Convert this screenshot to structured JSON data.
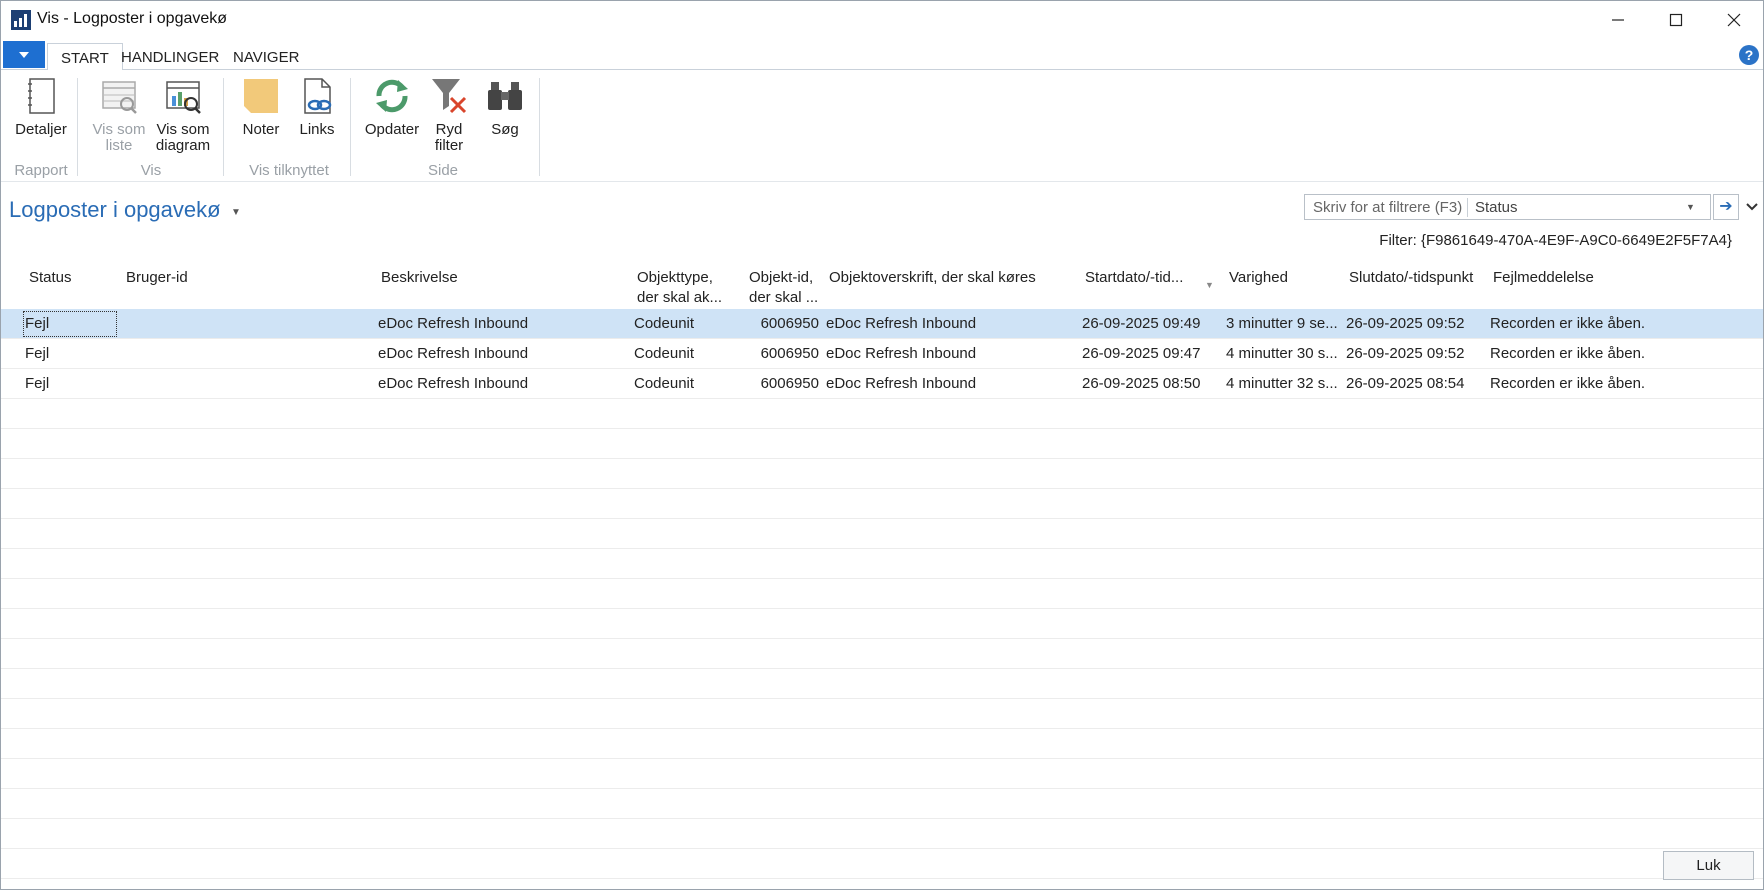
{
  "window": {
    "title": "Vis - Logposter i opgavekø"
  },
  "ribbon": {
    "tabs": [
      "START",
      "HANDLINGER",
      "NAVIGER"
    ],
    "buttons": {
      "details": "Detaljer",
      "list_line1": "Vis som",
      "list_line2": "liste",
      "chart_line1": "Vis som",
      "chart_line2": "diagram",
      "notes": "Noter",
      "links": "Links",
      "refresh": "Opdater",
      "clear_line1": "Ryd",
      "clear_line2": "filter",
      "search": "Søg"
    },
    "groups": {
      "report": "Rapport",
      "view": "Vis",
      "attached": "Vis tilknyttet",
      "page": "Side"
    }
  },
  "page": {
    "title": "Logposter i opgavekø",
    "filter_placeholder": "Skriv for at filtrere (F3)",
    "filter_field": "Status",
    "filter_text": "Filter: {F9861649-470A-4E9F-A9C0-6649E2F5F7A4}"
  },
  "table": {
    "headers": {
      "status": "Status",
      "user": "Bruger-id",
      "desc": "Beskrivelse",
      "objtype_1": "Objekttype,",
      "objtype_2": "der skal ak...",
      "objid_1": "Objekt-id,",
      "objid_2": "der skal ...",
      "caption": "Objektoverskrift, der skal køres",
      "start": "Startdato/-tid...",
      "duration": "Varighed",
      "end": "Slutdato/-tidspunkt",
      "error": "Fejlmeddelelse"
    },
    "rows": [
      {
        "status": "Fejl",
        "user": "",
        "desc": "eDoc Refresh Inbound",
        "objtype": "Codeunit",
        "objid": "6006950",
        "caption": "eDoc Refresh Inbound",
        "start": "26-09-2025 09:49",
        "duration": "3 minutter 9 se...",
        "end": "26-09-2025 09:52",
        "error": "Recorden er ikke åben."
      },
      {
        "status": "Fejl",
        "user": "",
        "desc": "eDoc Refresh Inbound",
        "objtype": "Codeunit",
        "objid": "6006950",
        "caption": "eDoc Refresh Inbound",
        "start": "26-09-2025 09:47",
        "duration": "4 minutter 30 s...",
        "end": "26-09-2025 09:52",
        "error": "Recorden er ikke åben."
      },
      {
        "status": "Fejl",
        "user": "",
        "desc": "eDoc Refresh Inbound",
        "objtype": "Codeunit",
        "objid": "6006950",
        "caption": "eDoc Refresh Inbound",
        "start": "26-09-2025 08:50",
        "duration": "4 minutter 32 s...",
        "end": "26-09-2025 08:54",
        "error": "Recorden er ikke åben."
      }
    ]
  },
  "footer": {
    "close_label": "Luk"
  },
  "colors": {
    "accent": "#1e6fd1",
    "title_blue": "#2a6cb5",
    "selected_row": "#cfe3f6"
  }
}
